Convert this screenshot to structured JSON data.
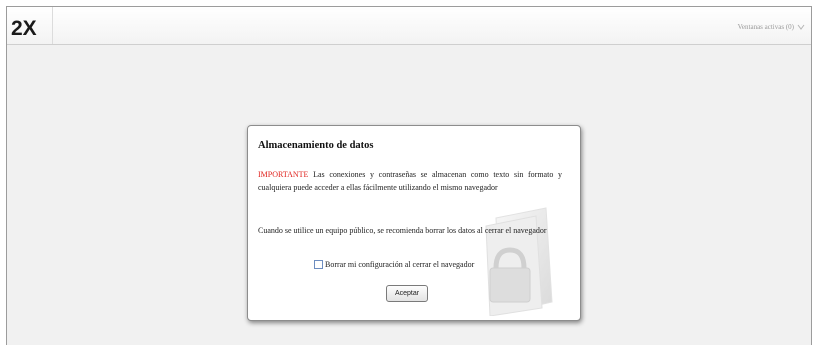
{
  "app": {
    "logo_text": "2X",
    "session_menu_label": "Ventanas activas (0)"
  },
  "dialog": {
    "title": "Almacenamiento de datos",
    "important_label": "IMPORTANTE",
    "paragraph1_rest": " Las conexiones y contraseñas se almacenan como texto sin formato y cualquiera puede acceder a ellas fácilmente utilizando el mismo navegador",
    "paragraph2": "Cuando se utilice un equipo público, se recomienda borrar los datos al cerrar el navegador",
    "checkbox_label": "Borrar mi configuración al cerrar el navegador",
    "checkbox_checked": false,
    "accept_label": "Aceptar"
  },
  "colors": {
    "important": "#e0241f",
    "logo": "#1a1a1a"
  },
  "icons": {
    "logo": "2x-logo-icon",
    "session_chevron": "chevron-down-icon",
    "background_art": "folder-lock-icon"
  }
}
